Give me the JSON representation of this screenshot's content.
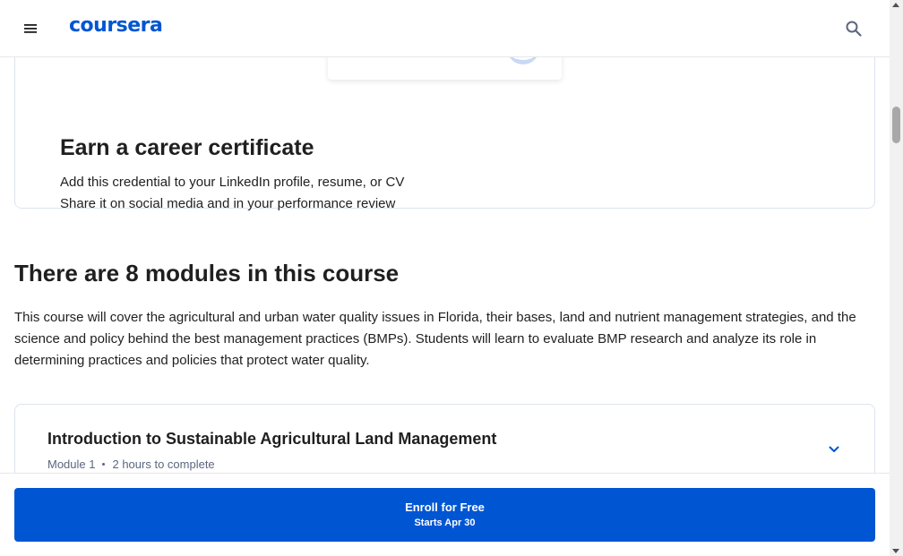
{
  "header": {
    "logo_text": "coursera",
    "menu_icon": "hamburger-menu-icon",
    "search_icon": "search-icon"
  },
  "certificate": {
    "title": "Earn a career certificate",
    "line1": "Add this credential to your LinkedIn profile, resume, or CV",
    "line2": "Share it on social media and in your performance review"
  },
  "modules": {
    "heading": "There are 8 modules in this course",
    "description": "This course will cover the agricultural and urban water quality issues in Florida, their bases, land and nutrient management strategies, and the science and policy behind the best management practices (BMPs).  Students will learn to evaluate BMP research and analyze its role in determining practices and policies that protect water quality.",
    "items": [
      {
        "title": "Introduction to Sustainable Agricultural Land Management",
        "module_label": "Module 1",
        "duration": "2 hours to complete",
        "expand_icon": "chevron-down-icon"
      }
    ]
  },
  "enroll": {
    "label": "Enroll for Free",
    "sub": "Starts Apr 30"
  },
  "colors": {
    "brand": "#0056d2",
    "text": "#1f1f1f",
    "meta": "#5b6780",
    "card_border": "#dde3ef"
  }
}
